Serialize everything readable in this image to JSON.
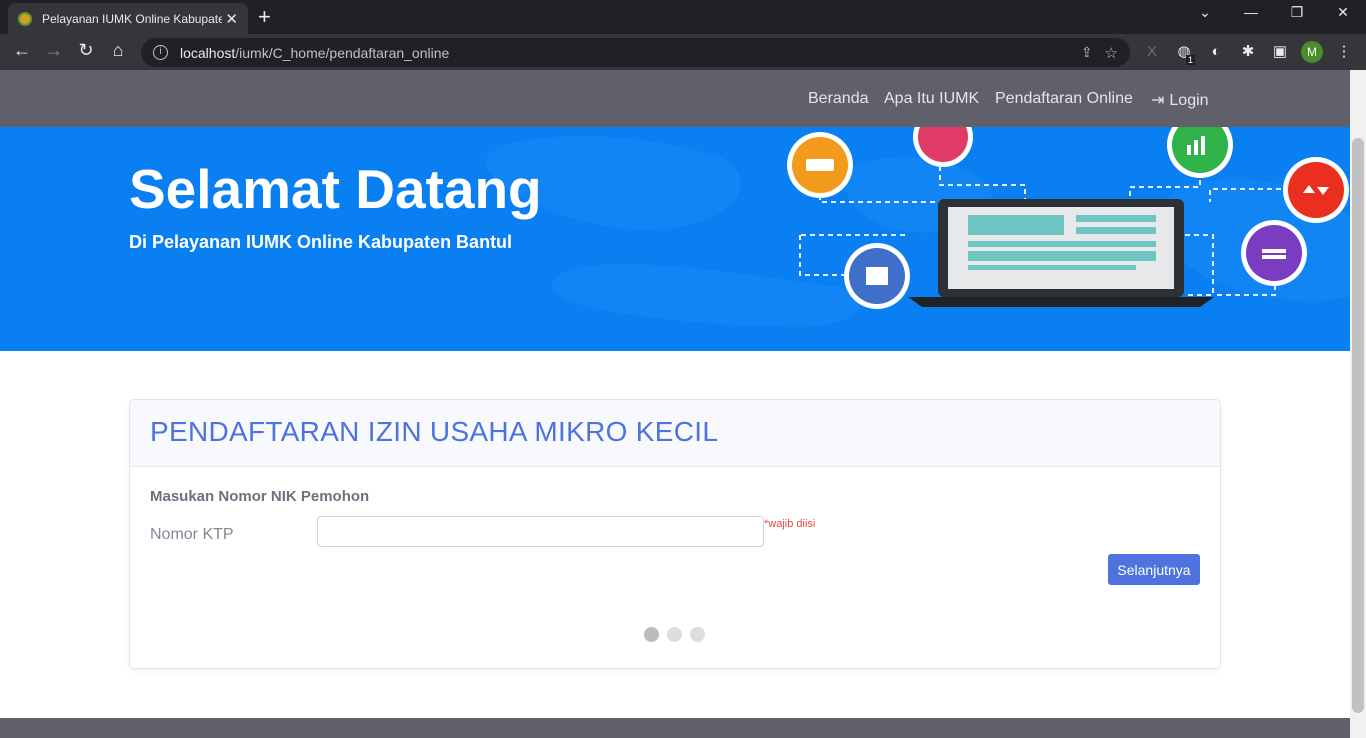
{
  "browser": {
    "tab_title": "Pelayanan IUMK Online Kabupaten Bantul",
    "tab_close": "✕",
    "new_tab": "+",
    "url_host": "localhost",
    "url_path": "/iumk/C_home/pendaftaran_online",
    "profile_initial": "M",
    "extension_badge": "1"
  },
  "nav": {
    "items": [
      "Beranda",
      "Apa Itu IUMK",
      "Pendaftaran Online"
    ],
    "login": "Login"
  },
  "hero": {
    "title": "Selamat Datang",
    "subtitle": "Di Pelayanan IUMK Online Kabupaten Bantul"
  },
  "form": {
    "heading": "PENDAFTARAN IZIN USAHA MIKRO KECIL",
    "subheading": "Masukan Nomor NIK Pemohon",
    "field_label": "Nomor KTP",
    "field_value": "",
    "required_note": "*wajib diisi",
    "submit_label": "Selanjutnya",
    "steps_total": 3,
    "step_active": 1
  },
  "colors": {
    "primary": "#4e73df",
    "navbar": "#5f6069",
    "hero": "#0a7ff2",
    "required": "#e74a3b"
  }
}
